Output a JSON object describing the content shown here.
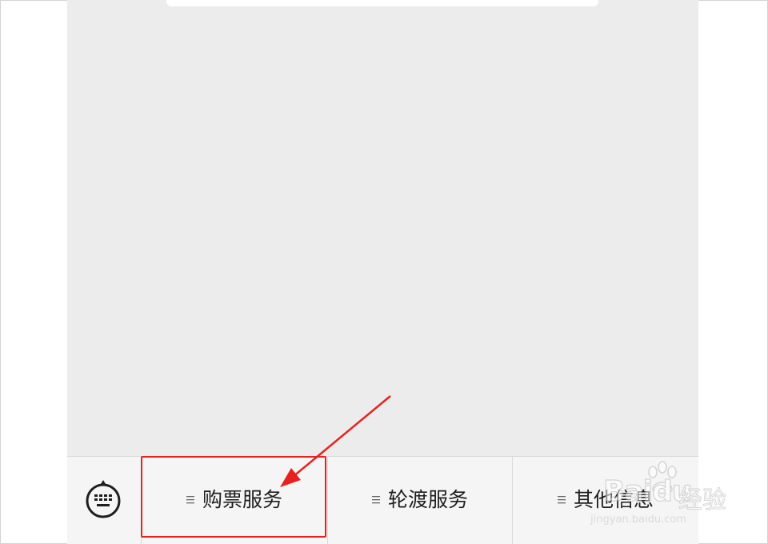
{
  "menu": {
    "items": [
      {
        "label": "购票服务",
        "icon": "list-icon"
      },
      {
        "label": "轮渡服务",
        "icon": "list-icon"
      },
      {
        "label": "其他信息",
        "icon": "list-icon"
      }
    ],
    "keyboard_icon": "keyboard-toggle-icon"
  },
  "annotation": {
    "highlight_color": "#e8211e",
    "target": "购票服务"
  },
  "watermark": {
    "brand": "Baidu",
    "cn": "经验",
    "url": "jingyan.baidu.com"
  },
  "colors": {
    "chat_background": "#ececec",
    "menu_background": "#f5f5f5",
    "text": "#1e1e1e"
  }
}
